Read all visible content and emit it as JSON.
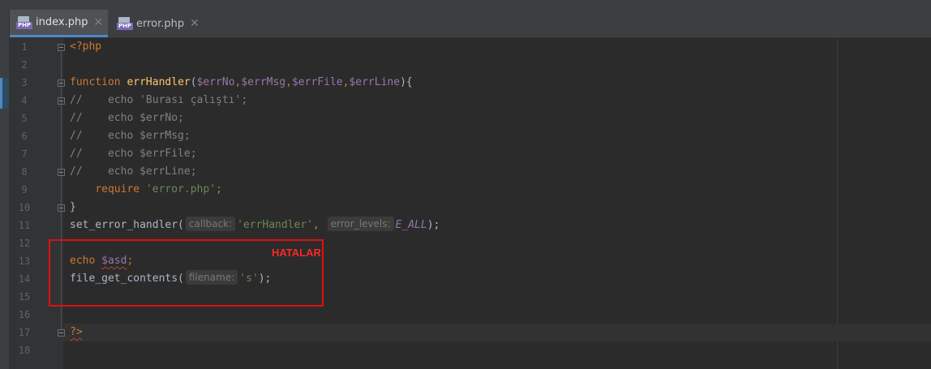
{
  "tabs": [
    {
      "label": "index.php",
      "icon": "php-file-icon",
      "badge": "PHP",
      "active": true
    },
    {
      "label": "error.php",
      "icon": "php-file-icon",
      "badge": "PHP",
      "active": false
    }
  ],
  "code_lines": [
    {
      "n": "1"
    },
    {
      "n": "2"
    },
    {
      "n": "3"
    },
    {
      "n": "4"
    },
    {
      "n": "5"
    },
    {
      "n": "6"
    },
    {
      "n": "7"
    },
    {
      "n": "8"
    },
    {
      "n": "9"
    },
    {
      "n": "10"
    },
    {
      "n": "11"
    },
    {
      "n": "12"
    },
    {
      "n": "13"
    },
    {
      "n": "14"
    },
    {
      "n": "15"
    },
    {
      "n": "16"
    },
    {
      "n": "17"
    },
    {
      "n": "18"
    }
  ],
  "code": {
    "l1_open": "<?php",
    "l3_kw": "function",
    "l3_fn": "errHandler",
    "l3_p1": "$errNo",
    "l3_p2": "$errMsg",
    "l3_p3": "$errFile",
    "l3_p4": "$errLine",
    "l4": "//    echo 'Burası çalıştı';",
    "l5": "//    echo $errNo;",
    "l6": "//    echo $errMsg;",
    "l7": "//    echo $errFile;",
    "l8": "//    echo $errLine;",
    "l9_kw": "require",
    "l9_str": "'error.php'",
    "l10": "}",
    "l11_fn": "set_error_handler(",
    "l11_hint1": "callback:",
    "l11_str": "'errHandler'",
    "l11_hint2": "error_levels:",
    "l11_const": "E_ALL",
    "l11_end": ");",
    "l13_kw": "echo",
    "l13_var": "$asd",
    "l14_fn": "file_get_contents(",
    "l14_hint": "filename:",
    "l14_str": "'s'",
    "l14_end": ");",
    "l17_close": "?>"
  },
  "annotation": {
    "label": "HATALAR",
    "color": "#e01010"
  },
  "colors": {
    "keyword": "#cc7832",
    "function": "#ffc66d",
    "variable": "#9876aa",
    "string": "#6a8759",
    "comment": "#808080",
    "default": "#a9b7c6",
    "background": "#2b2b2b"
  }
}
